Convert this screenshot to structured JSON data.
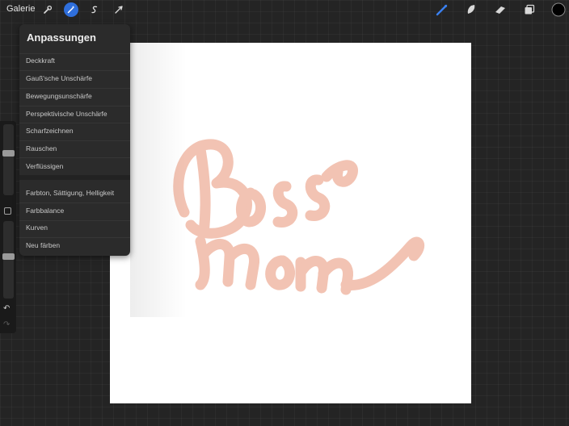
{
  "topbar": {
    "gallery_label": "Galerie",
    "left_tools": [
      {
        "name": "wrench-icon",
        "active": false
      },
      {
        "name": "magic-wand-icon",
        "active": true
      },
      {
        "name": "selection-icon",
        "active": false
      },
      {
        "name": "transform-icon",
        "active": false
      }
    ],
    "right_tools": [
      "brush-icon",
      "smudge-icon",
      "eraser-icon",
      "layers-icon",
      "color-swatch"
    ],
    "active_color": "#000000",
    "accent_color": "#2f6fdc"
  },
  "panel": {
    "title": "Anpassungen",
    "group1": [
      "Deckkraft",
      "Gauß'sche Unschärfe",
      "Bewegungsunschärfe",
      "Perspektivische Unschärfe",
      "Scharfzeichnen",
      "Rauschen",
      "Verflüssigen"
    ],
    "group2": [
      "Farbton, Sättigung, Helligkeit",
      "Farbbalance",
      "Kurven",
      "Neu färben"
    ]
  },
  "sidebar": {
    "brush_size_level": 0.6,
    "opacity_level": 0.55,
    "undo_icon": "undo-icon",
    "redo_icon": "redo-icon"
  },
  "canvas": {
    "background": "#ffffff",
    "lettering_color": "#f2c3b3"
  }
}
